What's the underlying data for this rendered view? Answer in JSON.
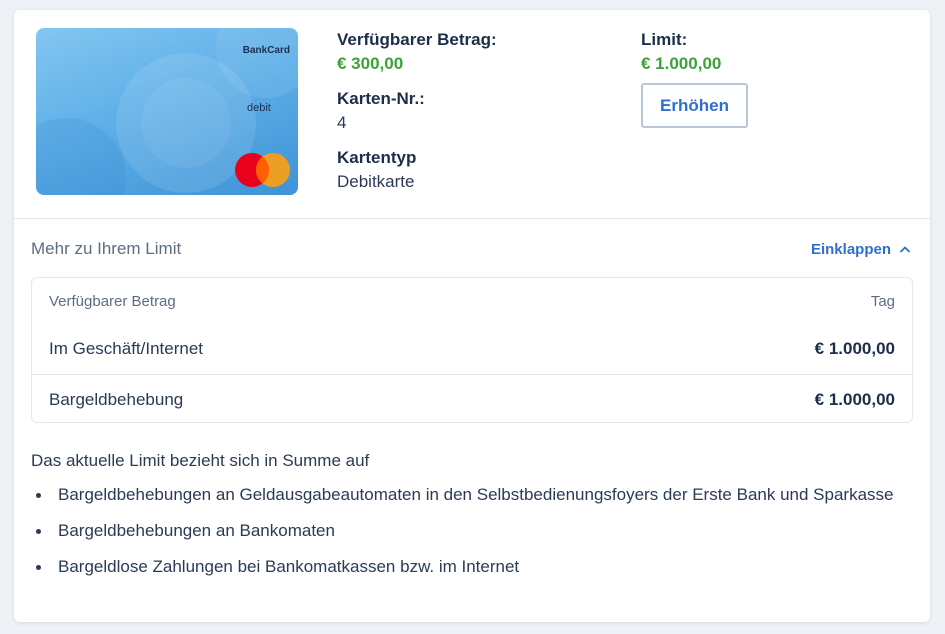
{
  "card": {
    "brand": "BankCard",
    "type_label": "debit",
    "network_icon": "mastercard-logo",
    "colors": {
      "gradient_start": "#83c6f1",
      "gradient_end": "#3e93d6",
      "mc_red": "#eb001b",
      "mc_yellow": "#f79e1b"
    }
  },
  "details": {
    "available_label": "Verfügbarer Betrag:",
    "available_value": "€ 300,00",
    "card_no_label": "Karten-Nr.:",
    "card_no_value": "4",
    "card_type_label": "Kartentyp",
    "card_type_value": "Debitkarte",
    "limit_label": "Limit:",
    "limit_value": "€ 1.000,00",
    "raise_button": "Erhöhen"
  },
  "limit_section": {
    "title": "Mehr zu Ihrem Limit",
    "collapse_label": "Einklappen",
    "collapse_icon": "chevron-up-icon",
    "table": {
      "header_left": "Verfügbarer Betrag",
      "header_right": "Tag",
      "rows": [
        {
          "label": "Im Geschäft/Internet",
          "value": "€ 1.000,00"
        },
        {
          "label": "Bargeldbehebung",
          "value": "€ 1.000,00"
        }
      ]
    },
    "note": "Das aktuelle Limit bezieht sich in Summe auf",
    "bullets": [
      "Bargeldbehebungen an Geldausgabeautomaten in den Selbstbedienungsfoyers der Erste Bank und Sparkasse",
      "Bargeldbehebungen an Bankomaten",
      "Bargeldlose Zahlungen bei Bankomatkassen bzw. im Internet"
    ]
  },
  "colors": {
    "accent": "#2f6fcf",
    "amount_green": "#3aa335",
    "text_dark": "#1c2e4a"
  }
}
